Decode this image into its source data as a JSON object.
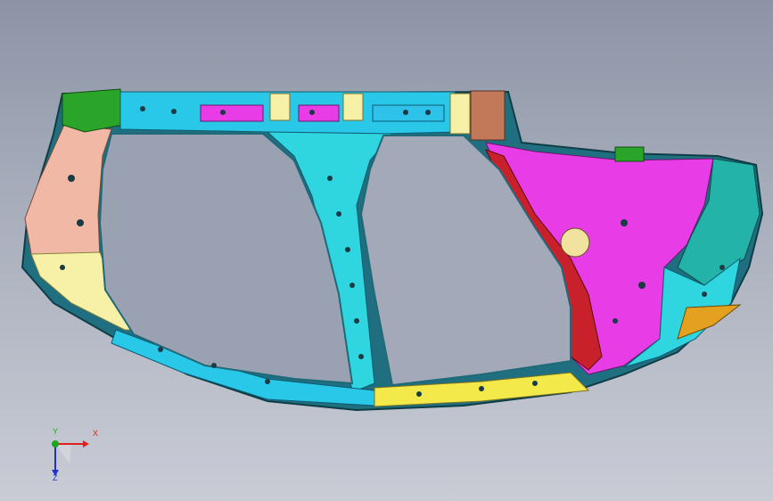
{
  "viewer": {
    "background_top": "#8c94a6",
    "background_bottom": "#c9ccd5"
  },
  "model": {
    "part_colors": {
      "roof_rail": "#29c7e8",
      "pillar": "#2fd6df",
      "sill": "#f4e94a",
      "front_pillar": "#f2b8a6",
      "rear_quarter": "#e83de6",
      "wheel_arch": "#c9212c",
      "bracket": "#2aa52a",
      "fillet": "#f7f1a8",
      "rear_teal": "#23b3a8",
      "tab": "#e3a11f"
    }
  },
  "triad": {
    "x_label": "X",
    "y_label": "Y",
    "z_label": "Z",
    "x_color": "#e0201c",
    "y_color": "#1da51d",
    "z_color": "#1f2fd0"
  }
}
